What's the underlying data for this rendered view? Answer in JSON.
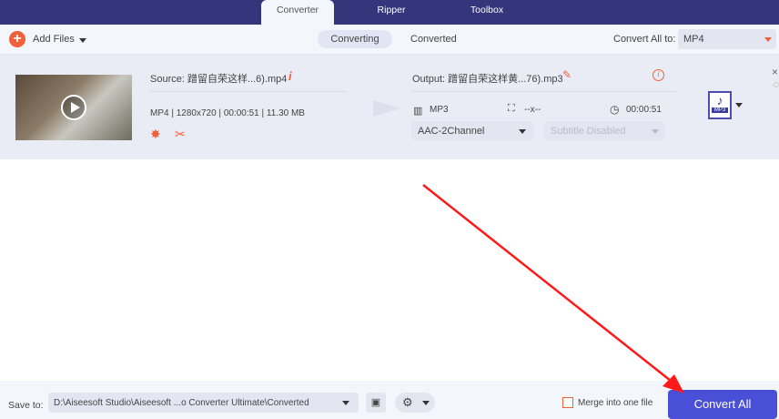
{
  "tabs": [
    {
      "label": "Converter"
    },
    {
      "label": "Ripper"
    },
    {
      "label": "Toolbox"
    }
  ],
  "toolbar": {
    "add_files": "Add Files",
    "sub_tabs": [
      {
        "label": "Converting"
      },
      {
        "label": "Converted"
      }
    ],
    "convert_all_to_label": "Convert All to:",
    "convert_all_to_value": "MP4"
  },
  "item": {
    "source": "Source: 蹭留自荣这样...6).mp4",
    "meta": {
      "format": "MP4",
      "resolution": "1280x720",
      "duration": "00:00:51",
      "size": "11.30 MB"
    },
    "output": "Output: 蹭留自荣这样黄...76).mp3",
    "out_format": "MP3",
    "out_resolution": "--x--",
    "out_duration": "00:00:51",
    "audio_track": "AAC-2Channel",
    "subtitle": "Subtitle Disabled",
    "format_badge": "MP3"
  },
  "bottom": {
    "save_to_label": "Save to:",
    "save_path": "D:\\Aiseesoft Studio\\Aiseesoft ...o Converter Ultimate\\Converted",
    "merge_label": "Merge into one file",
    "convert_all": "Convert All"
  },
  "colors": {
    "nav": "#34357b",
    "accent": "#f2603a",
    "primary": "#4a4fd8",
    "annotation": "#ff1a1a"
  }
}
